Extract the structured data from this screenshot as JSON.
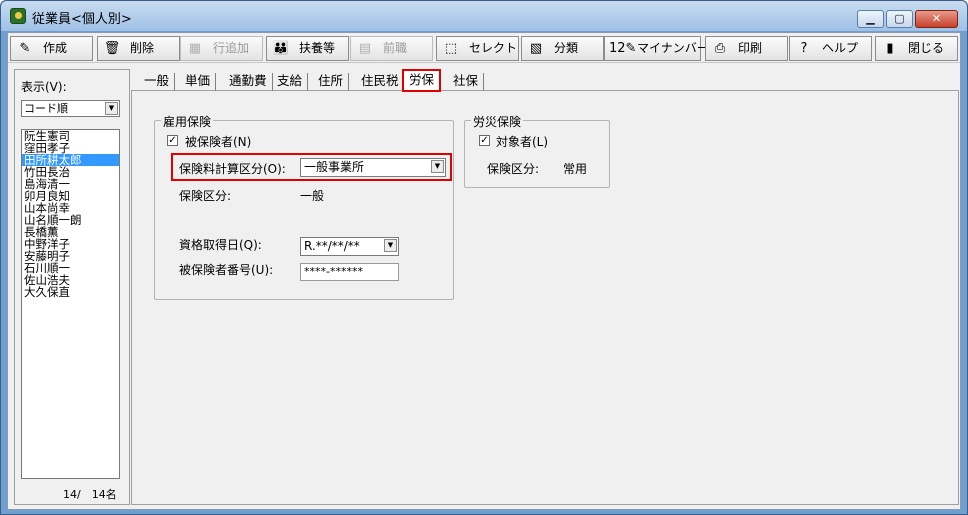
{
  "window": {
    "title": "従業員<個人別>"
  },
  "toolbar": [
    {
      "label": "作成",
      "icon": "create-icon",
      "glyph": "✎",
      "enabled": true
    },
    {
      "label": "削除",
      "icon": "trash-icon",
      "glyph": "🗑",
      "enabled": true
    },
    {
      "label": "行追加",
      "icon": "add-row-icon",
      "glyph": "▦",
      "enabled": false
    },
    {
      "label": "扶養等",
      "icon": "family-icon",
      "glyph": "👪",
      "enabled": true
    },
    {
      "label": "前職",
      "icon": "document-icon",
      "glyph": "▤",
      "enabled": false
    },
    {
      "label": "セレクト",
      "icon": "select-icon",
      "glyph": "⬚",
      "enabled": true
    },
    {
      "label": "分類",
      "icon": "classify-icon",
      "glyph": "▧",
      "enabled": true
    },
    {
      "label": "マイナンバー",
      "icon": "mynumber-icon",
      "glyph": "12✎",
      "enabled": true
    },
    {
      "label": "印刷",
      "icon": "printer-icon",
      "glyph": "⎙",
      "enabled": true
    },
    {
      "label": "ヘルプ",
      "icon": "help-icon",
      "glyph": "?",
      "enabled": true
    },
    {
      "label": "閉じる",
      "icon": "close-door-icon",
      "glyph": "▮",
      "enabled": true
    }
  ],
  "left": {
    "display_label": "表示(V):",
    "sort_value": "コード順",
    "employees": [
      "阮生憲司",
      "窪田孝子",
      "田所耕太郎",
      "竹田長治",
      "島海清一",
      "卯月良知",
      "山本尚幸",
      "山名順一朗",
      "長橋薫",
      "中野洋子",
      "安藤明子",
      "石川順一",
      "佐山浩夫",
      "大久保直"
    ],
    "selected_index": 2,
    "count": "14/　14名"
  },
  "tabs": [
    "一般",
    "単価",
    "通勤費",
    "支給",
    "住所",
    "住民税",
    "労保",
    "社保"
  ],
  "active_tab": 6,
  "koyo": {
    "group_label": "雇用保険",
    "insured_label": "被保険者(N)",
    "insured_checked": true,
    "calc_label": "保険料計算区分(O):",
    "calc_value": "一般事業所",
    "kubun_label": "保険区分:",
    "kubun_value": "一般",
    "acq_label": "資格取得日(Q):",
    "acq_value": "R.**/**/**",
    "number_label": "被保険者番号(U):",
    "number_value": "****-******"
  },
  "rosai": {
    "group_label": "労災保険",
    "target_label": "対象者(L)",
    "target_checked": true,
    "kubun_label": "保険区分:",
    "kubun_value": "常用"
  },
  "colors": {
    "highlight": "#e00000",
    "selection": "#3399ff"
  }
}
